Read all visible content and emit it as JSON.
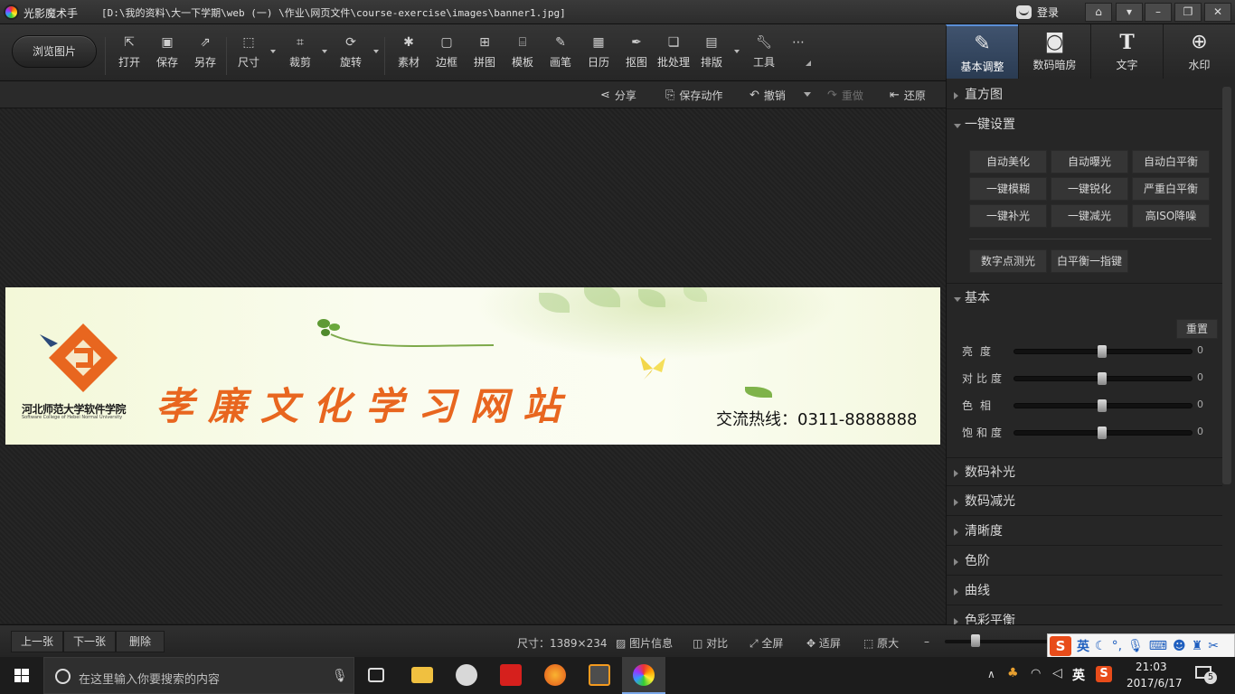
{
  "titlebar": {
    "app_name": "光影魔术手",
    "file_path": "[D:\\我的资料\\大一下学期\\web (一) \\作业\\网页文件\\course-exercise\\images\\banner1.jpg]",
    "login": "登录"
  },
  "toolbar": {
    "browse": "浏览图片",
    "tools": [
      {
        "label": "打开",
        "icon": "open-icon"
      },
      {
        "label": "保存",
        "icon": "save-icon"
      },
      {
        "label": "另存",
        "icon": "save-as-icon"
      },
      {
        "label": "尺寸",
        "icon": "resize-icon"
      },
      {
        "label": "裁剪",
        "icon": "crop-icon"
      },
      {
        "label": "旋转",
        "icon": "rotate-icon"
      },
      {
        "label": "素材",
        "icon": "material-icon"
      },
      {
        "label": "边框",
        "icon": "frame-icon"
      },
      {
        "label": "拼图",
        "icon": "collage-icon"
      },
      {
        "label": "模板",
        "icon": "template-icon"
      },
      {
        "label": "画笔",
        "icon": "brush-icon"
      },
      {
        "label": "日历",
        "icon": "calendar-icon"
      },
      {
        "label": "抠图",
        "icon": "cutout-icon"
      },
      {
        "label": "批处理",
        "icon": "batch-icon"
      },
      {
        "label": "排版",
        "icon": "layout-icon"
      },
      {
        "label": "工具",
        "icon": "wrench-icon"
      }
    ]
  },
  "right_tabs": [
    {
      "label": "基本调整",
      "icon": "edit-icon",
      "active": true
    },
    {
      "label": "数码暗房",
      "icon": "camera-icon",
      "active": false
    },
    {
      "label": "文字",
      "icon": "text-icon",
      "active": false
    },
    {
      "label": "水印",
      "icon": "watermark-icon",
      "active": false
    }
  ],
  "actions": {
    "share": "分享",
    "save_action": "保存动作",
    "undo": "撤销",
    "redo": "重做",
    "restore": "还原"
  },
  "banner": {
    "school_name": "河北师范大学软件学院",
    "school_name_en": "Software College of Hebei Normal University",
    "site_title": "孝廉文化学习网站",
    "hotline": "交流热线：0311-8888888",
    "accent_color": "#e8661f"
  },
  "panel": {
    "histogram": "直方图",
    "one_click": "一键设置",
    "one_click_buttons": [
      "自动美化",
      "自动曝光",
      "自动白平衡",
      "一键模糊",
      "一键锐化",
      "严重白平衡",
      "一键补光",
      "一键减光",
      "高ISO降噪"
    ],
    "extra_buttons": [
      "数字点测光",
      "白平衡一指键"
    ],
    "basic": "基本",
    "reset": "重置",
    "sliders": [
      {
        "label": "亮度",
        "value": "0"
      },
      {
        "label": "对比度",
        "value": "0"
      },
      {
        "label": "色相",
        "value": "0"
      },
      {
        "label": "饱和度",
        "value": "0"
      }
    ],
    "sections": [
      "数码补光",
      "数码减光",
      "清晰度",
      "色阶",
      "曲线",
      "色彩平衡"
    ]
  },
  "bottom": {
    "prev": "上一张",
    "next": "下一张",
    "delete": "删除",
    "size": "尺寸：1389×234",
    "info": "图片信息",
    "compare": "对比",
    "fullscreen": "全屏",
    "fit": "适屏",
    "original": "原大"
  },
  "ime": {
    "lang": "英"
  },
  "taskbar": {
    "search_placeholder": "在这里输入你要搜索的内容",
    "tray_lang": "英",
    "time": "21:03",
    "date": "2017/6/17",
    "notifications": "5"
  }
}
